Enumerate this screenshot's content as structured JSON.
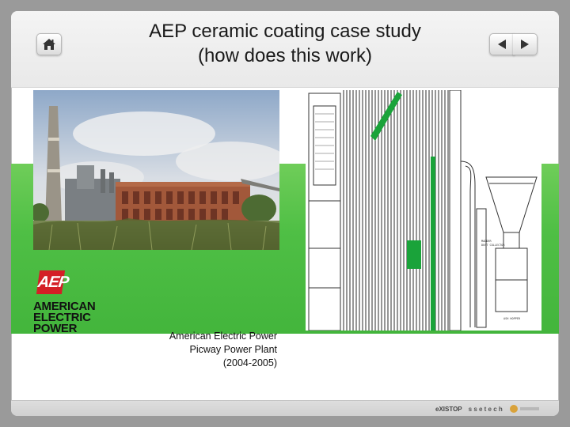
{
  "slide": {
    "title_line1": "AEP ceramic coating case study",
    "title_line2": "(how does this work)"
  },
  "nav": {
    "home_icon": "home-icon",
    "prev_icon": "arrow-left-icon",
    "next_icon": "arrow-right-icon"
  },
  "logo": {
    "mark": "AEP",
    "line1": "AMERICAN",
    "line2": "ELECTRIC",
    "line3": "POWER"
  },
  "caption": {
    "line1": "American Electric Power",
    "line2": "Picway Power Plant",
    "line3": "(2004-2005)"
  },
  "footer": {
    "logo1": "eXISTOP",
    "logo2": "s s e t e c h"
  },
  "colors": {
    "band": "#4fbf45",
    "highlight": "#1aa33a",
    "aep_red": "#d41f26"
  }
}
